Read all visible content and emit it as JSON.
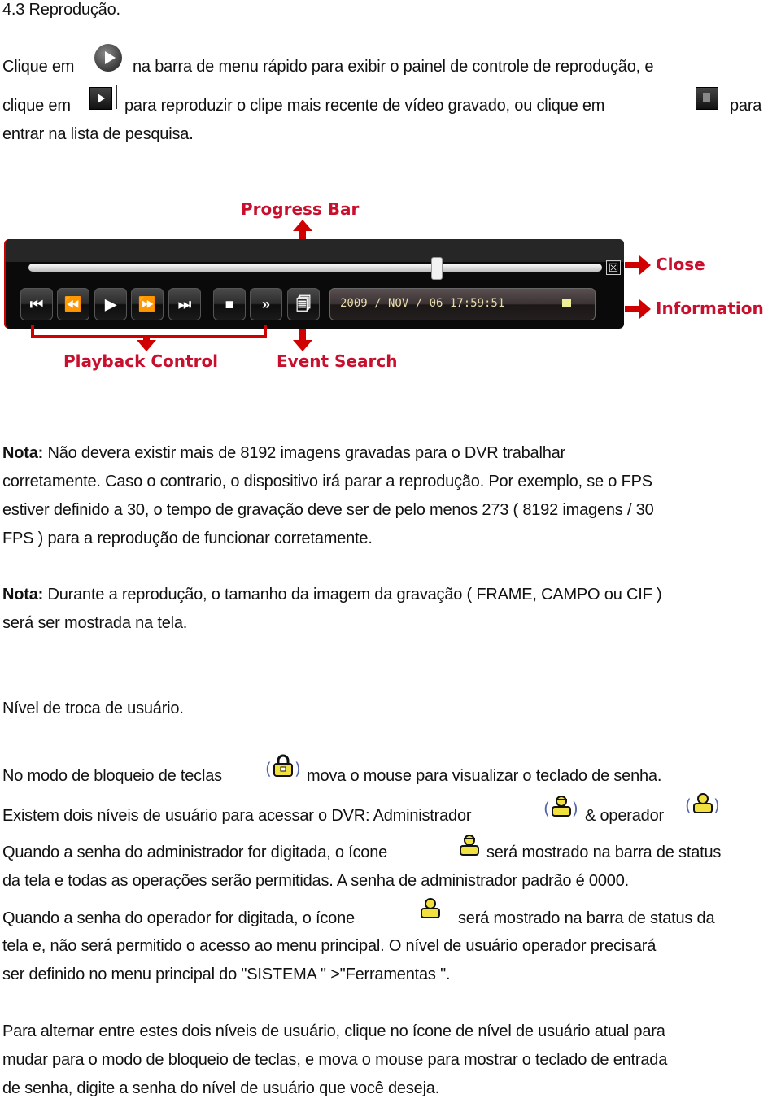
{
  "section_title": "4.3 Reprodução.",
  "intro": {
    "line1_a": "Clique em",
    "line1_b": "na barra de menu rápido para exibir o painel de controle de reprodução, e",
    "line2_a": "clique em",
    "line2_b": "para reproduzir o clipe mais recente de vídeo gravado, ou clique em",
    "line2_c": "para",
    "line3": "entrar na lista de pesquisa.",
    "icons": [
      "playback-circle-icon",
      "play-latest-icon",
      "search-list-icon"
    ]
  },
  "player": {
    "progress_fraction": 0.71,
    "buttons": [
      {
        "name": "skip-to-start",
        "glyph": "⏮"
      },
      {
        "name": "rewind",
        "glyph": "⏪"
      },
      {
        "name": "play",
        "glyph": "▶"
      },
      {
        "name": "fast-forward",
        "glyph": "⏩"
      },
      {
        "name": "skip-to-end",
        "glyph": "⏭"
      },
      {
        "name": "stop",
        "glyph": "■"
      },
      {
        "name": "slow",
        "glyph": "»"
      },
      {
        "name": "event-search",
        "glyph": "🗐"
      }
    ],
    "close_glyph": "☒",
    "info_datetime": "2009 / NOV / 06  17:59:51",
    "accent_color": "#d00000"
  },
  "annotations": {
    "progress_bar": "Progress Bar",
    "close": "Close",
    "information": "Information",
    "playback_control": "Playback Control",
    "event_search": "Event Search"
  },
  "notes": {
    "note1_label": "Nota:",
    "note1_line1": " Não devera existir mais de 8192 imagens gravadas para o DVR trabalhar",
    "note1_line2": "corretamente.  Caso o contrario, o dispositivo irá parar a reprodução.  Por exemplo, se o FPS",
    "note1_line3": "estiver definido a 30, o tempo de gravação deve ser de pelo menos 273 ( 8192 imagens / 30",
    "note1_line4": "FPS ) para a reprodução de funcionar corretamente.",
    "note2_label": "Nota:",
    "note2_line1": " Durante a reprodução, o tamanho da imagem da gravação ( FRAME, CAMPO ou CIF )",
    "note2_line2": "será ser mostrada na tela."
  },
  "user_level": {
    "heading": "Nível de troca de usuário.",
    "keylock_a": "No modo de bloqueio de teclas",
    "keylock_b": "mova o mouse para visualizar o teclado de senha.",
    "levels_a": "Existem dois níveis de usuário para acessar o DVR: Administrador",
    "levels_b": "& operador",
    "admin_line1_a": "Quando a senha do administrador for digitada, o ícone",
    "admin_line1_b": "será mostrado na barra de status",
    "admin_line2": "da tela e todas as operações serão permitidas.  A senha de administrador padrão é 0000.",
    "oper_line1_a": "Quando a senha do operador for digitada, o ícone",
    "oper_line1_b": "será mostrado na barra de status da",
    "oper_line2": "tela e, não será  permitido o acesso ao menu principal.  O nível de usuário operador precisará",
    "oper_line3": "ser definido no menu principal do \"SISTEMA \" >\"Ferramentas \".",
    "switch_line1": "Para alternar entre estes dois níveis de usuário, clique no ícone de nível de usuário atual para",
    "switch_line2": "mudar para o modo de bloqueio de teclas, e mova o mouse para mostrar o teclado de entrada",
    "switch_line3": "de senha, digite a senha do nível de usuário que você deseja.",
    "icon_color": "#f0e040"
  }
}
